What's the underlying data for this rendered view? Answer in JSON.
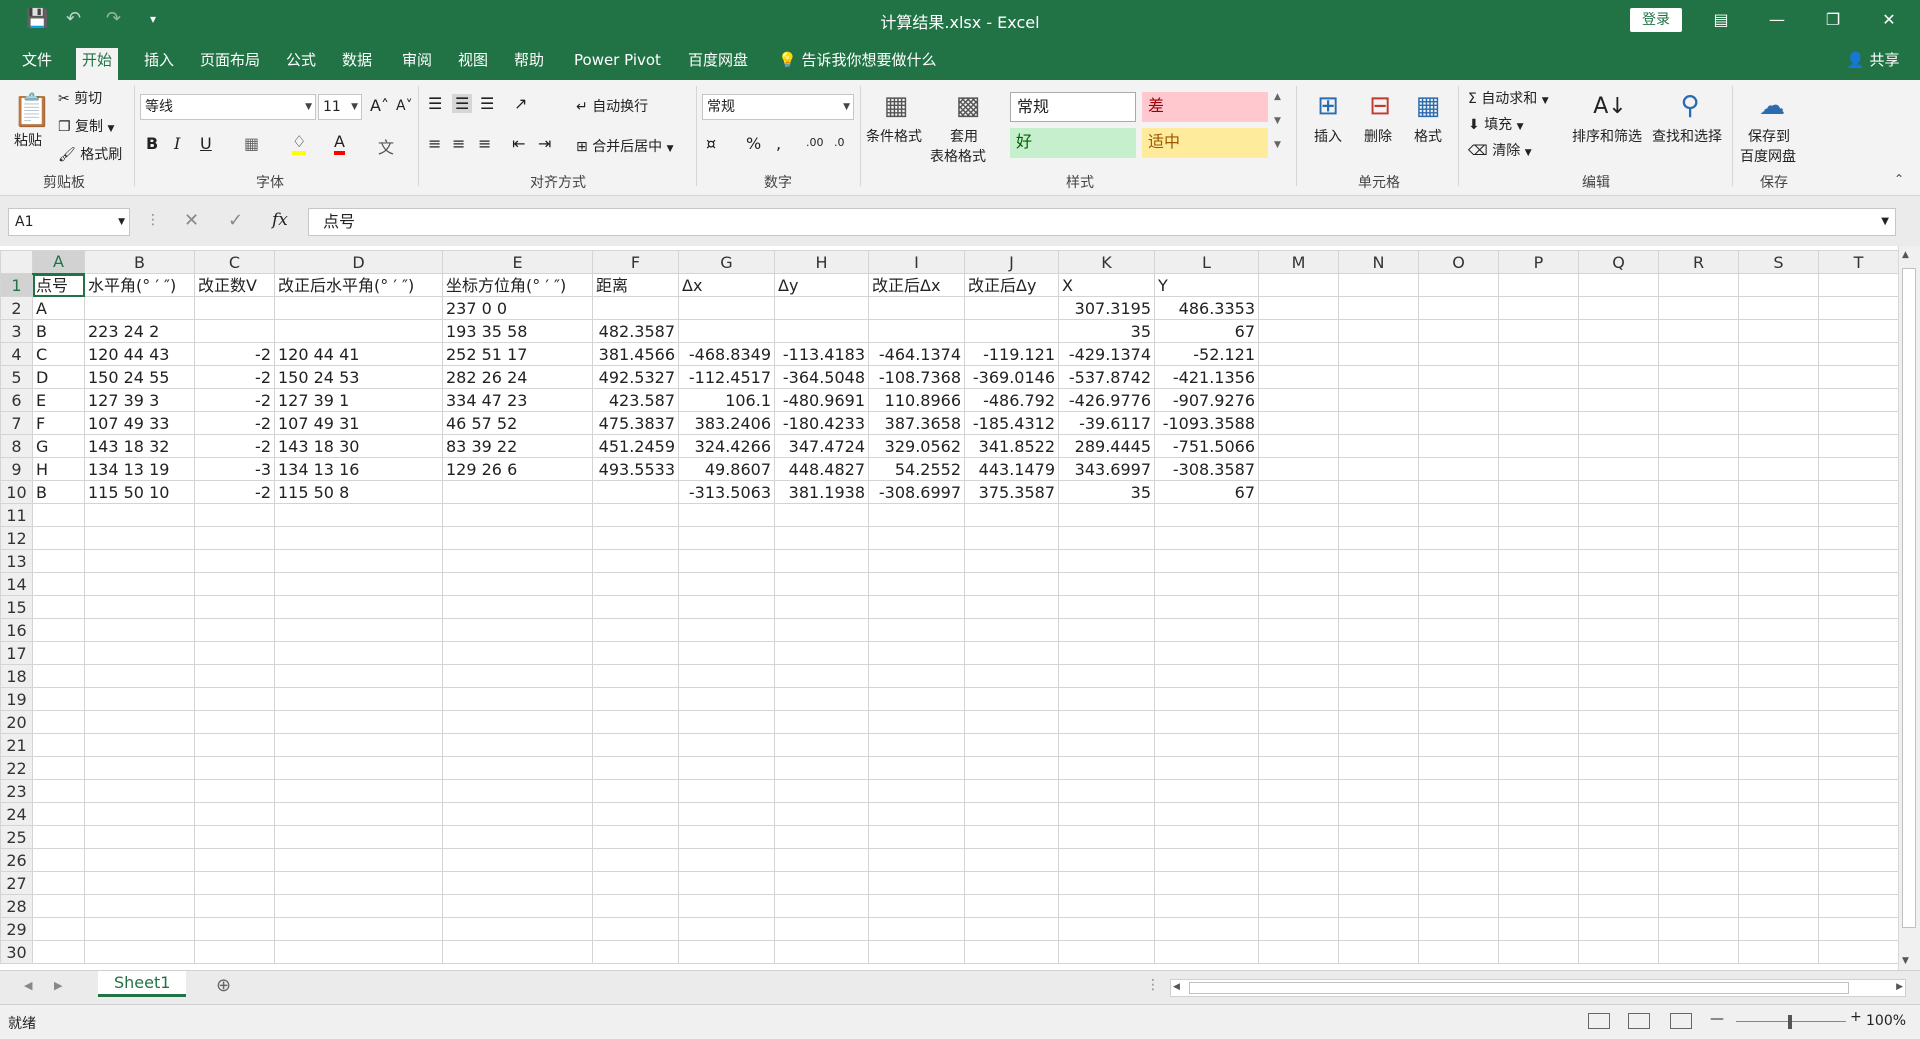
{
  "app": {
    "title": "计算结果.xlsx  -  Excel",
    "login_label": "登录",
    "share_label": "共享"
  },
  "tabs": [
    {
      "label": "文件"
    },
    {
      "label": "开始"
    },
    {
      "label": "插入"
    },
    {
      "label": "页面布局"
    },
    {
      "label": "公式"
    },
    {
      "label": "数据"
    },
    {
      "label": "审阅"
    },
    {
      "label": "视图"
    },
    {
      "label": "帮助"
    },
    {
      "label": "Power Pivot"
    },
    {
      "label": "百度网盘"
    }
  ],
  "tellme": "告诉我你想要做什么",
  "ribbon": {
    "clipboard": {
      "paste": "粘贴",
      "cut": "剪切",
      "copy": "复制",
      "format_painter": "格式刷",
      "label": "剪贴板"
    },
    "font": {
      "name": "等线",
      "size": "11",
      "label": "字体"
    },
    "alignment": {
      "wrap": "自动换行",
      "merge": "合并后居中",
      "label": "对齐方式"
    },
    "number": {
      "format": "常规",
      "label": "数字"
    },
    "styles": {
      "cond": "条件格式",
      "table_line1": "套用",
      "table_line2": "表格格式",
      "normal": "常规",
      "bad": "差",
      "good": "好",
      "neutral": "适中",
      "label": "样式"
    },
    "cells": {
      "insert": "插入",
      "delete": "删除",
      "format": "格式",
      "label": "单元格"
    },
    "editing": {
      "autosum": "自动求和",
      "fill": "填充",
      "clear": "清除",
      "sort": "排序和筛选",
      "find": "查找和选择",
      "label": "编辑"
    },
    "save": {
      "line1": "保存到",
      "line2": "百度网盘",
      "label": "保存"
    }
  },
  "formula_bar": {
    "name_box": "A1",
    "fx": "fx",
    "value": "点号"
  },
  "columns": [
    "A",
    "B",
    "C",
    "D",
    "E",
    "F",
    "G",
    "H",
    "I",
    "J",
    "K",
    "L",
    "M",
    "N",
    "O",
    "P",
    "Q",
    "R",
    "S",
    "T"
  ],
  "rows": [
    [
      "点号",
      "水平角(° ′ ″)",
      "改正数V",
      "改正后水平角(° ′ ″)",
      "坐标方位角(° ′ ″)",
      "距离",
      "Δx",
      "Δy",
      "改正后Δx",
      "改正后Δy",
      "X",
      "Y"
    ],
    [
      "A",
      "",
      "",
      "",
      "237 0 0",
      "",
      "",
      "",
      "",
      "",
      "307.3195",
      "486.3353"
    ],
    [
      "B",
      "223 24 2",
      "",
      "",
      "193 35 58",
      "482.3587",
      "",
      "",
      "",
      "",
      "35",
      "67"
    ],
    [
      "C",
      "120 44 43",
      "-2",
      "120 44 41",
      "252 51 17",
      "381.4566",
      "-468.8349",
      "-113.4183",
      "-464.1374",
      "-119.121",
      "-429.1374",
      "-52.121"
    ],
    [
      "D",
      "150 24 55",
      "-2",
      "150 24 53",
      "282 26 24",
      "492.5327",
      "-112.4517",
      "-364.5048",
      "-108.7368",
      "-369.0146",
      "-537.8742",
      "-421.1356"
    ],
    [
      "E",
      "127 39 3",
      "-2",
      "127 39 1",
      "334 47 23",
      "423.587",
      "106.1",
      "-480.9691",
      "110.8966",
      "-486.792",
      "-426.9776",
      "-907.9276"
    ],
    [
      "F",
      "107 49 33",
      "-2",
      "107 49 31",
      "46 57 52",
      "475.3837",
      "383.2406",
      "-180.4233",
      "387.3658",
      "-185.4312",
      "-39.6117",
      "-1093.3588"
    ],
    [
      "G",
      "143 18 32",
      "-2",
      "143 18 30",
      "83 39 22",
      "451.2459",
      "324.4266",
      "347.4724",
      "329.0562",
      "341.8522",
      "289.4445",
      "-751.5066"
    ],
    [
      "H",
      "134 13 19",
      "-3",
      "134 13 16",
      "129 26 6",
      "493.5533",
      "49.8607",
      "448.4827",
      "54.2552",
      "443.1479",
      "343.6997",
      "-308.3587"
    ],
    [
      "B",
      "115 50 10",
      "-2",
      "115 50 8",
      "",
      "",
      "-313.5063",
      "381.1938",
      "-308.6997",
      "375.3587",
      "35",
      "67"
    ]
  ],
  "row_count": 30,
  "sheet_tab": "Sheet1",
  "status": "就绪",
  "zoom": "100%"
}
